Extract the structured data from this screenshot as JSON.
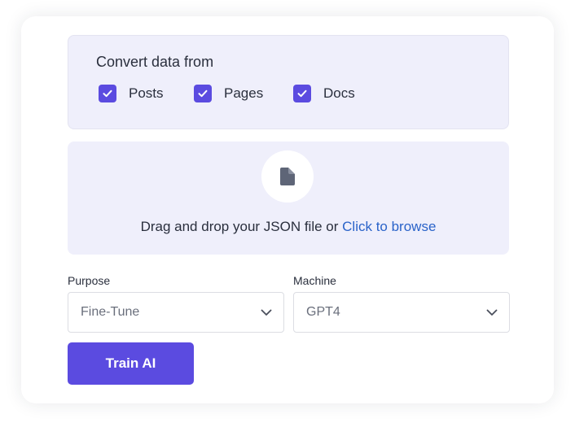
{
  "convert": {
    "title": "Convert data from",
    "options": [
      {
        "label": "Posts",
        "checked": true
      },
      {
        "label": "Pages",
        "checked": true
      },
      {
        "label": "Docs",
        "checked": true
      }
    ]
  },
  "upload": {
    "prompt": "Drag and drop your JSON file or ",
    "link_text": "Click to browse",
    "icon": "file-icon"
  },
  "purpose": {
    "label": "Purpose",
    "value": "Fine-Tune"
  },
  "machine": {
    "label": "Machine",
    "value": "GPT4"
  },
  "train_button": "Train AI",
  "colors": {
    "accent": "#5b4be0",
    "panel": "#efeffb",
    "link": "#2a63c9"
  }
}
